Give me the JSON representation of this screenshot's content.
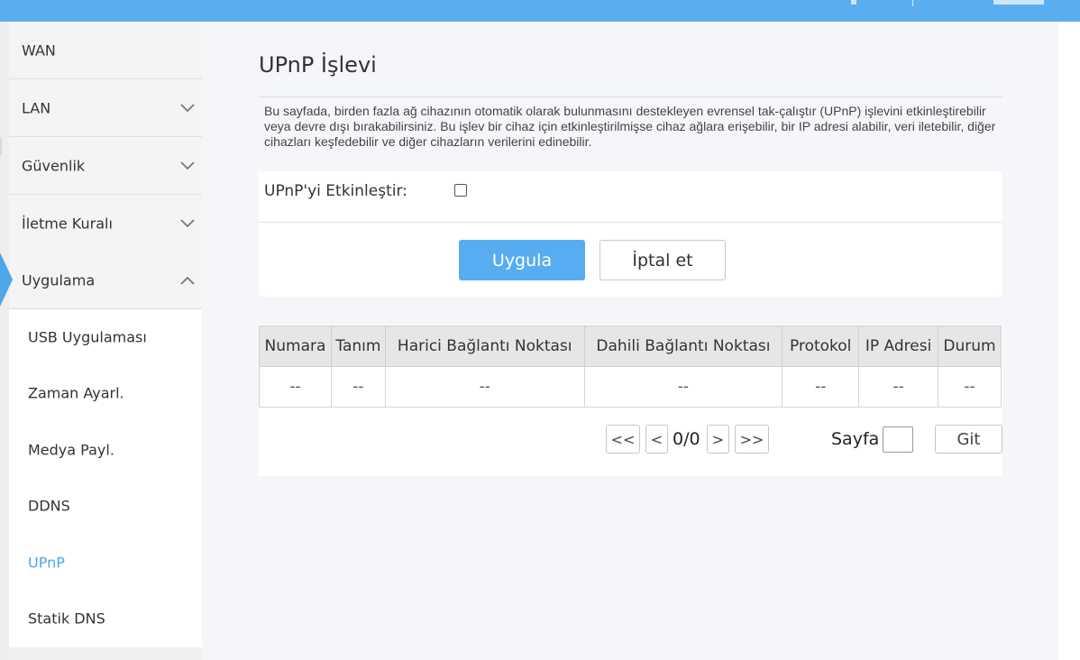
{
  "sidebar": {
    "main_items": [
      {
        "label": "WAN",
        "icon": ""
      },
      {
        "label": "LAN",
        "icon": "chevron-down-icon"
      },
      {
        "label": "Güvenlik",
        "icon": "chevron-down-icon"
      },
      {
        "label": "İletme Kuralı",
        "icon": "chevron-down-icon"
      },
      {
        "label": "Uygulama",
        "icon": "chevron-up-icon"
      }
    ],
    "sub_items": [
      {
        "label": "USB Uygulaması"
      },
      {
        "label": "Zaman Ayarl."
      },
      {
        "label": "Medya Payl."
      },
      {
        "label": "DDNS"
      },
      {
        "label": "UPnP",
        "active": true
      },
      {
        "label": "Statik DNS"
      }
    ]
  },
  "page": {
    "title": "UPnP İşlevi",
    "description": "Bu sayfada, birden fazla ağ cihazının otomatik olarak bulunmasını destekleyen evrensel tak-çalıştır (UPnP) işlevini etkinleştirebilir veya devre dışı bırakabilirsiniz. Bu işlev bir cihaz için etkinleştirilmişse cihaz ağlara erişebilir, bir IP adresi alabilir, veri iletebilir, diğer cihazları keşfedebilir ve diğer cihazların verilerini edinebilir.",
    "enable_label": "UPnP'yi Etkinleştir:",
    "enable_checked": false,
    "apply_label": "Uygula",
    "cancel_label": "İptal et"
  },
  "table": {
    "headers": [
      "Numara",
      "Tanım",
      "Harici Bağlantı Noktası",
      "Dahili Bağlantı Noktası",
      "Protokol",
      "IP Adresi",
      "Durum"
    ],
    "rows": [
      [
        "--",
        "--",
        "--",
        "--",
        "--",
        "--",
        "--"
      ]
    ]
  },
  "pagination": {
    "first": "<<",
    "prev": "<",
    "status": "0/0",
    "next": ">",
    "last": ">>",
    "page_label": "Sayfa",
    "page_value": "",
    "go_label": "Git"
  },
  "colors": {
    "accent": "#57adef",
    "topbar": "#5aaef0",
    "active_link": "#4ea6e8"
  }
}
